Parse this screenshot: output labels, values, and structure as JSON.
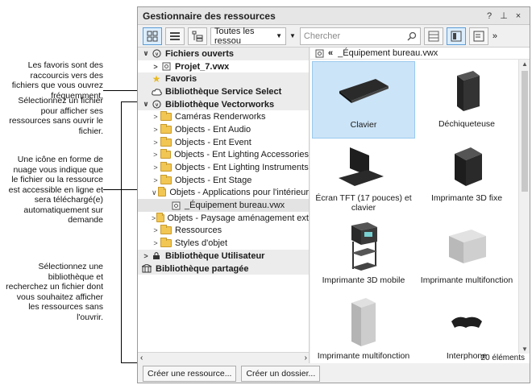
{
  "callouts": [
    "Les favoris sont des raccourcis vers des fichiers que vous ouvrez fréquemment.",
    "Sélectionnez un fichier pour afficher ses ressources sans ouvrir le fichier.",
    "Une icône en forme de nuage vous indique que le fichier ou la ressource est accessible en ligne et sera téléchargé(e) automatiquement sur demande",
    "Sélectionnez une bibliothèque et recherchez un fichier dont vous souhaitez afficher les ressources sans l'ouvrir."
  ],
  "palette": {
    "title": "Gestionnaire des ressources",
    "title_buttons": [
      "?",
      "⊥",
      "×"
    ],
    "filter_dropdown": "Toutes les ressou",
    "search_placeholder": "Chercher",
    "more_glyph": "»"
  },
  "tree": [
    {
      "label": "Fichiers ouverts",
      "type": "section",
      "twisty": "∨",
      "icon": "circle-v"
    },
    {
      "label": "Projet_7.vwx",
      "type": "file-bold",
      "twisty": ">",
      "icon": "file"
    },
    {
      "label": "Favoris",
      "type": "section",
      "twisty": "",
      "icon": "star"
    },
    {
      "label": "Bibliothèque Service Select",
      "type": "section",
      "twisty": "",
      "icon": "cloud"
    },
    {
      "label": "Bibliothèque Vectorworks",
      "type": "section",
      "twisty": "∨",
      "icon": "circle-v"
    },
    {
      "label": "Caméras Renderworks",
      "type": "folder",
      "twisty": ">"
    },
    {
      "label": "Objects - Ent Audio",
      "type": "folder",
      "twisty": ">"
    },
    {
      "label": "Objects - Ent Event",
      "type": "folder",
      "twisty": ">"
    },
    {
      "label": "Objects - Ent Lighting Accessories",
      "type": "folder",
      "twisty": ">"
    },
    {
      "label": "Objects - Ent Lighting Instruments",
      "type": "folder",
      "twisty": ">"
    },
    {
      "label": "Objects - Ent Stage",
      "type": "folder",
      "twisty": ">"
    },
    {
      "label": "Objets - Applications pour l'intérieur",
      "type": "folder",
      "twisty": "∨"
    },
    {
      "label": "_Équipement bureau.vwx",
      "type": "file-selected",
      "twisty": "",
      "icon": "file"
    },
    {
      "label": "Objets - Paysage aménagement ext",
      "type": "folder",
      "twisty": ">"
    },
    {
      "label": "Ressources",
      "type": "folder",
      "twisty": ">"
    },
    {
      "label": "Styles d'objet",
      "type": "folder",
      "twisty": ">"
    },
    {
      "label": "Bibliothèque Utilisateur",
      "type": "section",
      "twisty": ">",
      "icon": "lock"
    },
    {
      "label": "Bibliothèque partagée",
      "type": "section",
      "twisty": "",
      "icon": "building"
    }
  ],
  "breadcrumb": {
    "back": "«",
    "file": "_Équipement bureau.vwx"
  },
  "resources": [
    {
      "label": "Clavier",
      "icon": "keyboard"
    },
    {
      "label": "Déchiqueteuse",
      "icon": "shredder"
    },
    {
      "label": "Écran TFT (17 pouces) et clavier",
      "icon": "monitor"
    },
    {
      "label": "Imprimante 3D fixe",
      "icon": "printer3d"
    },
    {
      "label": "Imprimante 3D mobile",
      "icon": "printer3d-mobile"
    },
    {
      "label": "Imprimante multifonction",
      "icon": "mfp"
    },
    {
      "label": "Imprimante multifonction",
      "icon": "mfp-tall"
    },
    {
      "label": "Interphone",
      "icon": "phone"
    }
  ],
  "status": "20 éléments",
  "footer": {
    "new_resource": "Créer une ressource...",
    "new_folder": "Créer un dossier..."
  }
}
